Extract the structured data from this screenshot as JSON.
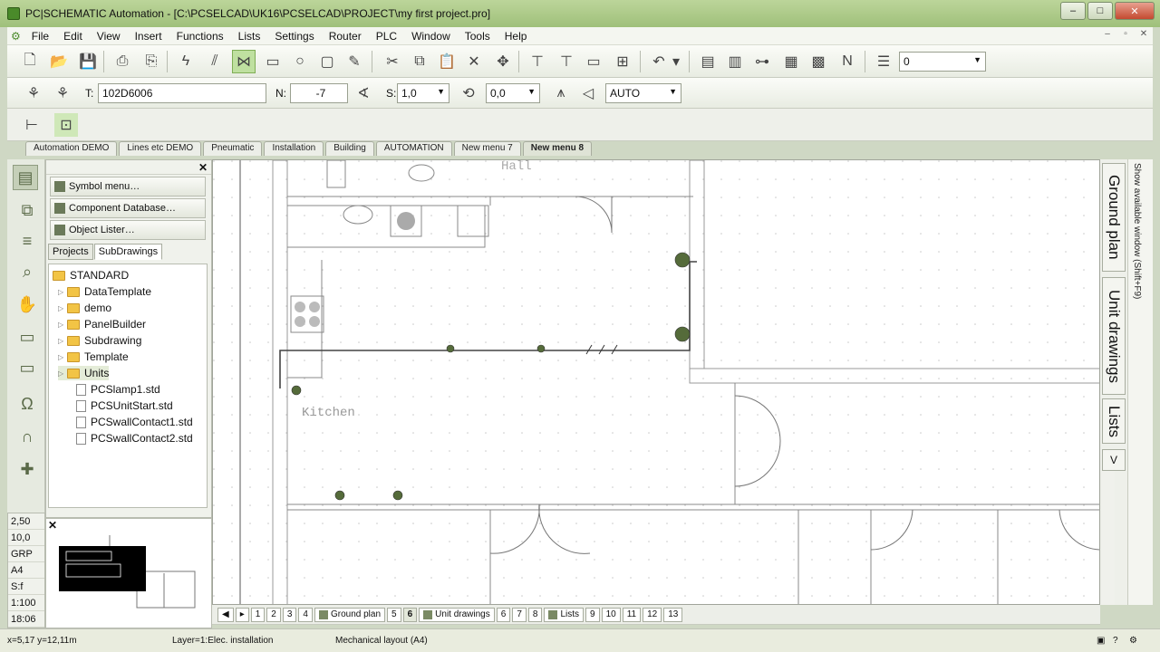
{
  "window": {
    "title": "PC|SCHEMATIC Automation - [C:\\PCSELCAD\\UK16\\PCSELCAD\\PROJECT\\my first project.pro]",
    "controls": [
      "–",
      "□",
      "✕"
    ]
  },
  "menu": [
    "File",
    "Edit",
    "View",
    "Insert",
    "Functions",
    "Lists",
    "Settings",
    "Router",
    "PLC",
    "Window",
    "Tools",
    "Help"
  ],
  "toolbar1": {
    "layer_combo": "0"
  },
  "toolbar2": {
    "t_label": "T:",
    "t_value": "102D6006",
    "n_label": "N:",
    "n_value": "-7",
    "s_label": "S:",
    "s_value": "1,0",
    "angle_value": "0,0",
    "auto_value": "AUTO"
  },
  "menu_tabs": [
    "Automation DEMO",
    "Lines etc DEMO",
    "Pneumatic",
    "Installation",
    "Building",
    "AUTOMATION",
    "New menu 7",
    "New menu 8"
  ],
  "left_panel": {
    "buttons": [
      "Symbol menu…",
      "Component Database…",
      "Object Lister…"
    ],
    "tabs": [
      "Projects",
      "SubDrawings"
    ],
    "tree": {
      "root": "STANDARD",
      "folders": [
        "DataTemplate",
        "demo",
        "PanelBuilder",
        "Subdrawing",
        "Template",
        "Units"
      ],
      "files": [
        "PCSlamp1.std",
        "PCSUnitStart.std",
        "PCSwallContact1.std",
        "PCSwallContact2.std"
      ]
    }
  },
  "info_values": [
    "2,50",
    "10,0",
    "GRP",
    "A4",
    "S:f",
    "1:100",
    "18:06"
  ],
  "drawing": {
    "room_label": "Kitchen",
    "top_label": "Hall"
  },
  "right_tabs": [
    "Ground plan",
    "Unit drawings",
    "Lists",
    "V"
  ],
  "right_hint": "Show available window (Shift+F9)",
  "page_tabs": [
    "1",
    "2",
    "3",
    "4",
    "Ground plan",
    "5",
    "6",
    "Unit drawings",
    "6",
    "7",
    "8",
    "Lists",
    "9",
    "10",
    "11",
    "12",
    "13"
  ],
  "status": {
    "coords": "x=5,17 y=12,11m",
    "layer": "Layer=1:Elec. installation",
    "page": "Mechanical layout (A4)"
  },
  "colors": {
    "titlebar": "#a9c785",
    "accent": "#7fae55"
  }
}
